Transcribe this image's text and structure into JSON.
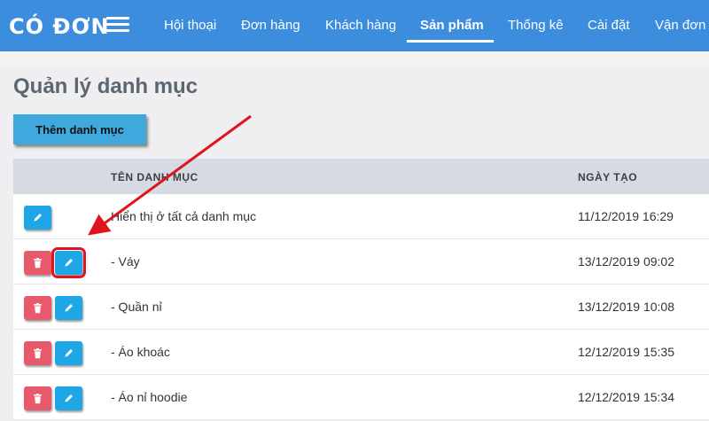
{
  "brand": "CÓ ĐƠN",
  "nav": [
    {
      "label": "Hội thoại",
      "active": false
    },
    {
      "label": "Đơn hàng",
      "active": false
    },
    {
      "label": "Khách hàng",
      "active": false
    },
    {
      "label": "Sản phẩm",
      "active": true
    },
    {
      "label": "Thống kê",
      "active": false
    },
    {
      "label": "Cài đặt",
      "active": false
    },
    {
      "label": "Vận đơn",
      "active": false
    }
  ],
  "page": {
    "title": "Quản lý danh mục",
    "add_button": "Thêm danh mục"
  },
  "table": {
    "headers": {
      "name": "TÊN DANH MỤC",
      "date": "NGÀY TẠO"
    },
    "rows": [
      {
        "name": "Hiển thị ở tất cả danh mục",
        "date": "11/12/2019 16:29",
        "deletable": false
      },
      {
        "name": "- Váy",
        "date": "13/12/2019 09:02",
        "deletable": true
      },
      {
        "name": "- Quần nỉ",
        "date": "13/12/2019 10:08",
        "deletable": true
      },
      {
        "name": "- Áo khoác",
        "date": "12/12/2019 15:35",
        "deletable": true
      },
      {
        "name": "- Áo nỉ hoodie",
        "date": "12/12/2019 15:34",
        "deletable": true
      }
    ]
  },
  "colors": {
    "topbar": "#3c8dde",
    "add_button": "#3fa8dc",
    "delete_button": "#e85a6b",
    "edit_button": "#1ea6e6",
    "highlight": "#e0141e"
  },
  "icons": {
    "delete": "trash-icon",
    "edit": "pencil-icon"
  }
}
